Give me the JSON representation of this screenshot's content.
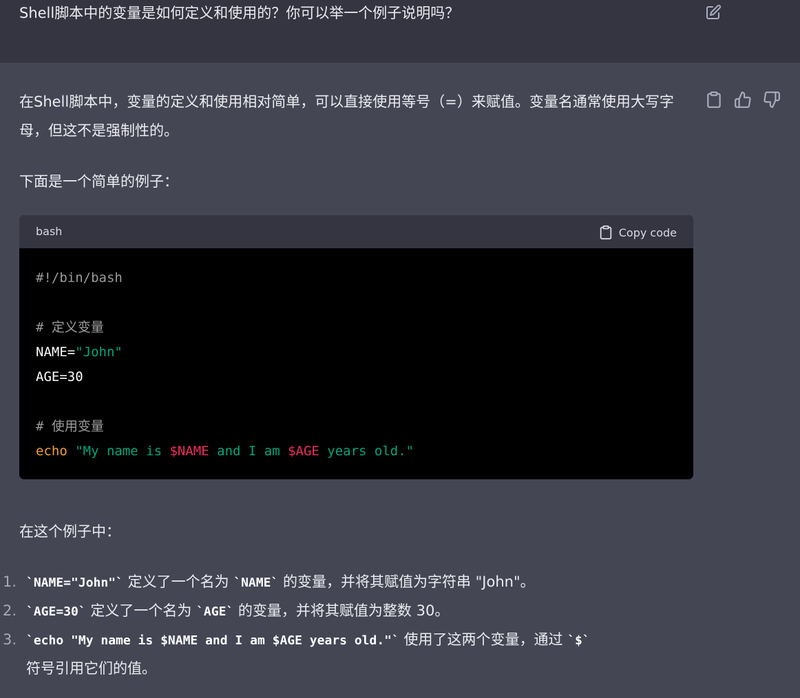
{
  "user_message": {
    "text": "Shell脚本中的变量是如何定义和使用的？你可以举一个例子说明吗？"
  },
  "assistant": {
    "intro": "在Shell脚本中，变量的定义和使用相对简单，可以直接使用等号（=）来赋值。变量名通常使用大写字母，但这不是强制性的。",
    "example_label": "下面是一个简单的例子：",
    "code_block": {
      "language": "bash",
      "copy_label": "Copy code",
      "lines": {
        "shebang": "#!/bin/bash",
        "comment1": "# 定义变量",
        "name_key": "NAME=",
        "name_val": "\"John\"",
        "age_line": "AGE=30",
        "comment2": "# 使用变量",
        "echo_kw": "echo",
        "echo_s1": " \"My name is ",
        "echo_v1": "$NAME",
        "echo_s2": " and I am ",
        "echo_v2": "$AGE",
        "echo_s3": " years old.\""
      }
    },
    "explain_label": "在这个例子中：",
    "list": [
      {
        "num": "1.",
        "code": "`NAME=\"John\"`",
        "text1": " 定义了一个名为 ",
        "code2": "`NAME`",
        "text2": " 的变量，并将其赋值为字符串 \"John\"。"
      },
      {
        "num": "2.",
        "code": "`AGE=30`",
        "text1": " 定义了一个名为 ",
        "code2": "`AGE`",
        "text2": " 的变量，并将其赋值为整数 30。"
      },
      {
        "num": "3.",
        "code": "`echo \"My name is $NAME and I am $AGE years old.\"`",
        "text1": " 使用了这两个变量，通过 ",
        "code2": "`$`",
        "text2": "",
        "cont": "符号引用它们的值。"
      }
    ]
  },
  "icons": {
    "edit": "edit-icon",
    "copy": "clipboard-icon",
    "like": "thumbs-up-icon",
    "dislike": "thumbs-down-icon"
  }
}
